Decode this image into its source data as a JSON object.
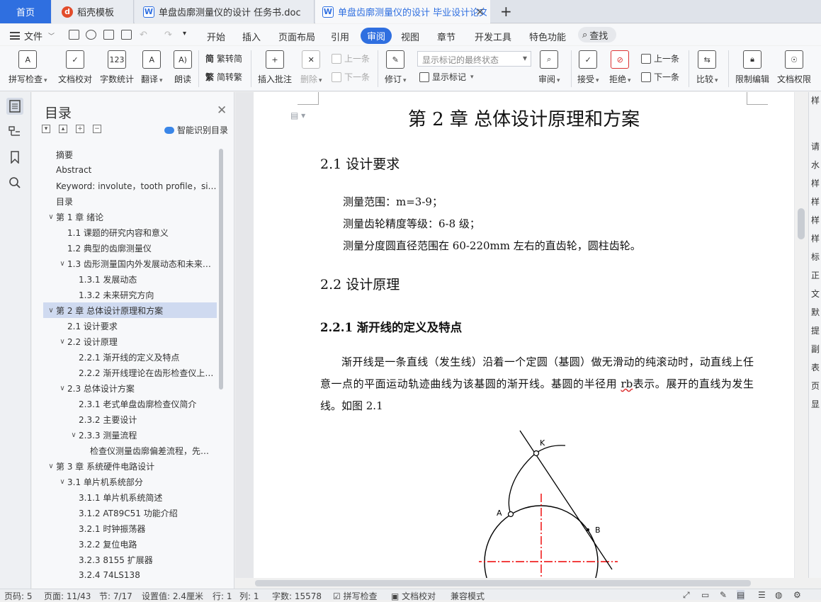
{
  "tabs": {
    "home": "首页",
    "tab1": "稻壳模板",
    "tab2": "单盘齿廓测量仪的设计 任务书.doc",
    "tab3": "单盘齿廓测量仪的设计 毕业设计论文",
    "add": "+"
  },
  "menu": {
    "file": "文件",
    "items": [
      "开始",
      "插入",
      "页面布局",
      "引用",
      "审阅",
      "视图",
      "章节",
      "开发工具",
      "特色功能"
    ],
    "active": "审阅",
    "search": "查找"
  },
  "ribbon": {
    "spellcheck": "拼写检查",
    "doc_proof": "文档校对",
    "word_count": "字数统计",
    "translate": "翻译",
    "read_aloud": "朗读",
    "trad_to_simp": "繁转简",
    "simp_to_trad": "简转繁",
    "insert_comment": "插入批注",
    "delete": "删除",
    "prev_comment": "上一条",
    "next_comment": "下一条",
    "revise": "修订",
    "mark_select": "显示标记的最终状态",
    "show_marks": "显示标记",
    "review": "审阅",
    "accept": "接受",
    "reject": "拒绝",
    "prev_change": "上一条",
    "next_change": "下一条",
    "compare": "比较",
    "restrict_edit": "限制编辑",
    "doc_permission": "文档权限",
    "count_icon_text": "123"
  },
  "toc": {
    "title": "目录",
    "smart": "智能识别目录",
    "items": [
      {
        "label": "摘要",
        "level": 0,
        "arrow": ""
      },
      {
        "label": "Abstract",
        "level": 0,
        "arrow": ""
      },
      {
        "label": "Keyword: involute，tooth profile，si…",
        "level": 0,
        "arrow": ""
      },
      {
        "label": "目录",
        "level": 0,
        "arrow": ""
      },
      {
        "label": "第 1 章  绪论",
        "level": 0,
        "arrow": "v"
      },
      {
        "label": "1.1  课题的研究内容和意义",
        "level": 1,
        "arrow": ""
      },
      {
        "label": "1.2  典型的齿廓测量仪",
        "level": 1,
        "arrow": ""
      },
      {
        "label": "1.3  齿形测量国内外发展动态和未来…",
        "level": 1,
        "arrow": "v"
      },
      {
        "label": "1.3.1 发展动态",
        "level": 2,
        "arrow": ""
      },
      {
        "label": "1.3.2 未来研究方向",
        "level": 2,
        "arrow": ""
      },
      {
        "label": "第 2 章  总体设计原理和方案",
        "level": 0,
        "arrow": "v",
        "selected": true
      },
      {
        "label": "2.1 设计要求",
        "level": 1,
        "arrow": ""
      },
      {
        "label": "2.2 设计原理",
        "level": 1,
        "arrow": "v"
      },
      {
        "label": "2.2.1 渐开线的定义及特点",
        "level": 2,
        "arrow": ""
      },
      {
        "label": "2.2.2 渐开线理论在齿形检查仪上…",
        "level": 2,
        "arrow": ""
      },
      {
        "label": "2.3 总体设计方案",
        "level": 1,
        "arrow": "v"
      },
      {
        "label": "2.3.1 老式单盘齿廓检查仪简介",
        "level": 2,
        "arrow": ""
      },
      {
        "label": "2.3.2 主要设计",
        "level": 2,
        "arrow": ""
      },
      {
        "label": "2.3.3 测量流程",
        "level": 2,
        "arrow": "v"
      },
      {
        "label": "检查仪测量齿廓偏差流程，先…",
        "level": 3,
        "arrow": ""
      },
      {
        "label": "第 3 章  系统硬件电路设计",
        "level": 0,
        "arrow": "v"
      },
      {
        "label": "3.1 单片机系统部分",
        "level": 1,
        "arrow": "v"
      },
      {
        "label": "3.1.1 单片机系统简述",
        "level": 2,
        "arrow": ""
      },
      {
        "label": "3.1.2 AT89C51 功能介绍",
        "level": 2,
        "arrow": ""
      },
      {
        "label": "3.2.1 时钟振荡器",
        "level": 2,
        "arrow": ""
      },
      {
        "label": "3.2.2 复位电路",
        "level": 2,
        "arrow": ""
      },
      {
        "label": "3.2.3 8155 扩展器",
        "level": 2,
        "arrow": ""
      },
      {
        "label": "3.2.4 74LS138",
        "level": 2,
        "arrow": ""
      }
    ]
  },
  "doc": {
    "chapter_title": "第 2 章  总体设计原理和方案",
    "s21": "2.1 设计要求",
    "req1": "测量范围：m=3-9；",
    "req2": "测量齿轮精度等级：6-8 级；",
    "req3": "测量分度圆直径范围在 60-220mm 左右的直齿轮，圆柱齿轮。",
    "s22": "2.2 设计原理",
    "s221": "2.2.1 渐开线的定义及特点",
    "body_a": "渐开线是一条直线（发生线）沿着一个定圆（基圆）做无滑动的纯滚动时，动直线上任意一点的平面运动轨迹曲线为该基圆的渐开线。基圆的半径用 ",
    "body_u": "rb",
    "body_b": "表示。展开的直线为发生线。如图 2.1",
    "fig_k": "K",
    "fig_a": "A",
    "fig_b": "B"
  },
  "right_panel": {
    "chars": "样\n\n\n\n\n请\n\n水\n\n样\n\n样\n\n样\n\n样\n\n标\n\n正\n\n文\n\n默\n\n提\n\n副\n\n表\n\n页\n\n显"
  },
  "status": {
    "page_num": "页码: 5",
    "pages": "页面: 11/43",
    "section": "节: 7/17",
    "setting": "设置值: 2.4厘米",
    "row": "行: 1",
    "col": "列: 1",
    "words": "字数: 15578",
    "spell": "拼写检查",
    "proof": "文档校对",
    "compat": "兼容模式"
  }
}
